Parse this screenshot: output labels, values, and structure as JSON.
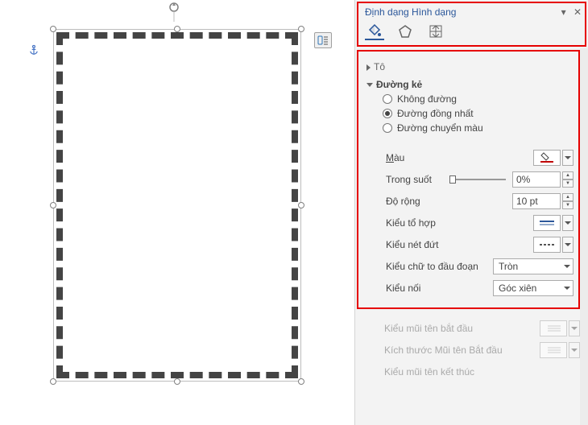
{
  "panel": {
    "title": "Định dạng Hình dạng",
    "section_fill": "Tô",
    "section_line": "Đường kẻ",
    "radios": {
      "noline": "Không đường",
      "solid": "Đường đồng nhất",
      "gradient": "Đường chuyển màu"
    },
    "props": {
      "color": "Màu",
      "transparency": "Trong suốt",
      "width": "Độ rộng",
      "compound": "Kiểu tổ hợp",
      "dash": "Kiểu nét đứt",
      "cap": "Kiểu chữ to đầu đoạn",
      "join": "Kiểu nối",
      "arrow_begin": "Kiểu mũi tên bắt đầu",
      "arrow_begin_size": "Kích thước Mũi tên Bắt đầu",
      "arrow_end": "Kiểu mũi tên kết thúc"
    },
    "values": {
      "transparency": "0%",
      "width": "10 pt",
      "cap": "Tròn",
      "join": "Góc xiên"
    }
  }
}
